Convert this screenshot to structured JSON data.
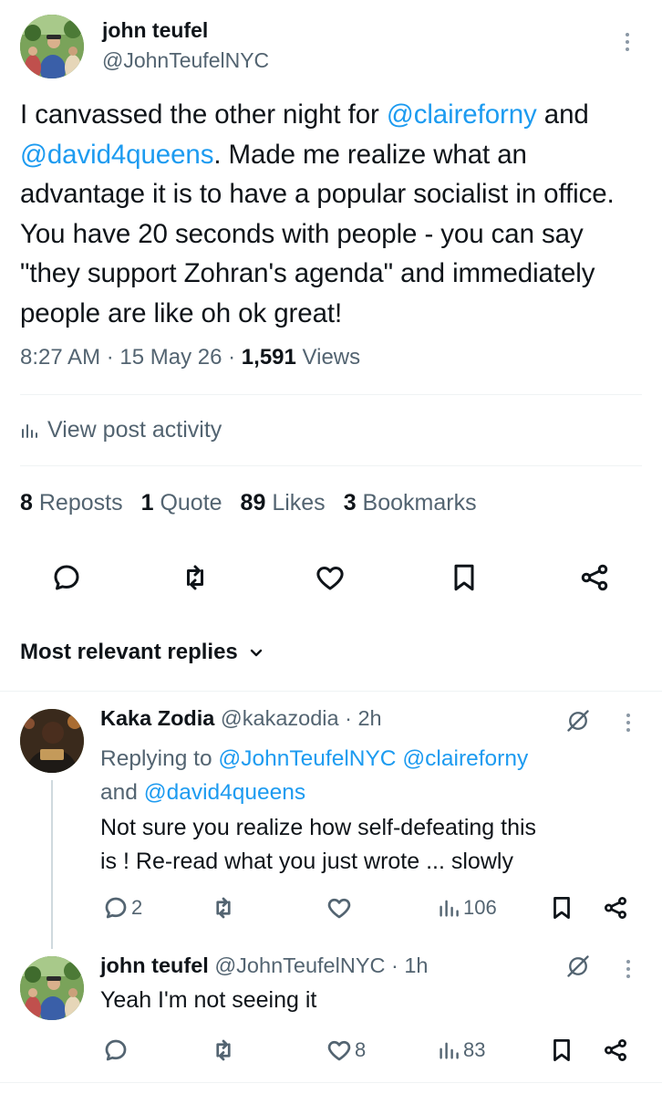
{
  "tweet": {
    "author_name": "john teufel",
    "author_handle": "@JohnTeufelNYC",
    "text_parts": {
      "t1": "I canvassed the other night for ",
      "m1": "@claireforny",
      "t2": "and ",
      "m2": "@david4queens",
      "t3": ". Made me realize what an advantage it is to have a popular socialist in office. You have 20 seconds with people - you can say \"they support Zohran's agenda\" and immediately people are like oh ok great!"
    },
    "time": "8:27 AM",
    "date": "15 May 26",
    "views_count": "1,591",
    "views_label": "Views",
    "activity_label": "View post activity",
    "stats": {
      "reposts_count": "8",
      "reposts_label": "Reposts",
      "quotes_count": "1",
      "quotes_label": "Quote",
      "likes_count": "89",
      "likes_label": "Likes",
      "bookmarks_count": "3",
      "bookmarks_label": "Bookmarks"
    }
  },
  "replies_header": "Most relevant replies",
  "replies": [
    {
      "name": "Kaka Zodia",
      "handle": "@kakazodia",
      "time": "2h",
      "replying_label": "Replying to",
      "replying_handles": [
        "@JohnTeufelNYC",
        "@claireforny"
      ],
      "replying_and": "and",
      "replying_last": "@david4queens",
      "text_line1": "Not sure you realize how self-defeating this",
      "text_line2": "is !  Re-read what you just wrote ... slowly",
      "reply_count": "2",
      "repost_count": "",
      "like_count": "",
      "views_count": "106"
    },
    {
      "name": "john teufel",
      "handle": "@JohnTeufelNYC",
      "time": "1h",
      "text_line1": "Yeah I'm not seeing it",
      "reply_count": "",
      "repost_count": "",
      "like_count": "8",
      "views_count": "83"
    }
  ],
  "colors": {
    "accent": "#1d9bf0",
    "muted": "#536471",
    "text": "#0f1419"
  },
  "icons": [
    "more-vertical-icon",
    "bar-chart-icon",
    "reply-icon",
    "repost-icon",
    "like-icon",
    "bookmark-icon",
    "share-icon",
    "chevron-down-icon",
    "grok-icon"
  ]
}
